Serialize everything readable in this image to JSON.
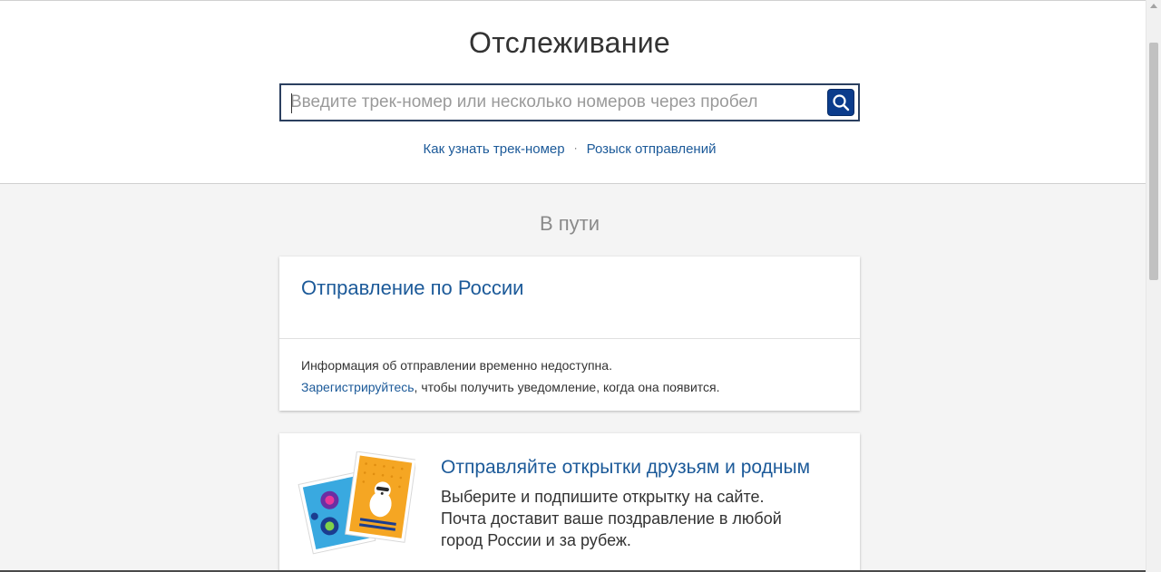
{
  "header": {
    "title": "Отслеживание"
  },
  "search": {
    "placeholder": "Введите трек-номер или несколько номеров через пробел",
    "value": "",
    "button_icon": "search-icon"
  },
  "help_links": [
    {
      "label": "Как узнать трек-номер"
    },
    {
      "label": "Розыск отправлений"
    }
  ],
  "help_links_separator": "·",
  "status_section": {
    "title": "В пути"
  },
  "tracking_card": {
    "title": "Отправление по России",
    "message": "Информация об отправлении временно недоступна.",
    "register_link": "Зарегистрируйтесь",
    "register_suffix": ", чтобы получить уведомление, когда она появится."
  },
  "promo_card": {
    "title": "Отправляйте открытки друзьям и родным",
    "lines": [
      "Выберите и подпишите открытку на сайте.",
      "Почта доставит ваше поздравление в любой",
      "город России и за рубеж."
    ],
    "image_icon": "postcards-illustration"
  },
  "colors": {
    "accent": "#1c5a99",
    "search_button": "#0b3c8c",
    "search_border": "#2b3f5f",
    "page_background": "#f4f4f4"
  }
}
